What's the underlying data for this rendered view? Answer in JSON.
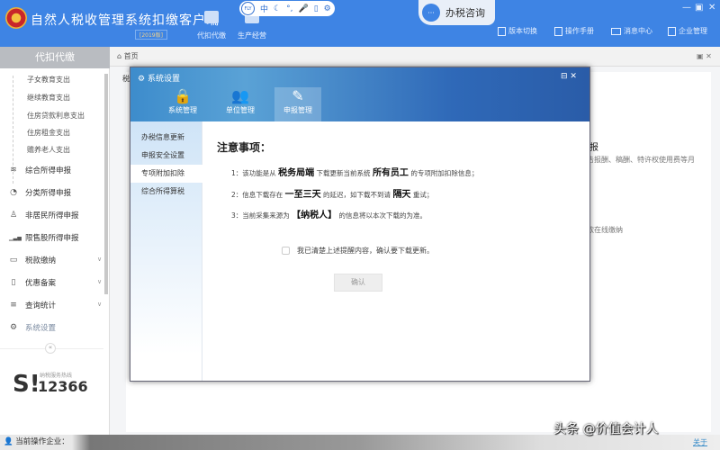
{
  "header": {
    "title": "自然人税收管理系统扣缴客户端",
    "subtitle": "[2019版]",
    "tools": [
      "代扣代缴",
      "生产经营"
    ],
    "flybar": {
      "fly": "FLY",
      "items": [
        "中",
        "☾",
        "°,",
        "🎤",
        "▯",
        "⚙"
      ]
    },
    "consult": "办税咨询",
    "links": [
      "版本切换",
      "操作手册",
      "消息中心",
      "企业管理"
    ],
    "window_controls": [
      "—",
      "▣",
      "✕"
    ]
  },
  "sidebar": {
    "title": "代扣代缴",
    "sub_items": [
      "子女教育支出",
      "继续教育支出",
      "住房贷款利息支出",
      "住房租金支出",
      "赡养老人支出"
    ],
    "items": [
      {
        "label": "综合所得申报",
        "icon": "≋"
      },
      {
        "label": "分类所得申报",
        "icon": "◔"
      },
      {
        "label": "非居民所得申报",
        "icon": "♙"
      },
      {
        "label": "限售股所得申报",
        "icon": "▁▃▅"
      },
      {
        "label": "税款缴纳",
        "icon": "▭"
      },
      {
        "label": "优惠备案",
        "icon": "▯"
      },
      {
        "label": "查询统计",
        "icon": "≡"
      },
      {
        "label": "系统设置",
        "icon": "⚙"
      }
    ],
    "collapse": "«",
    "hotline_label": "纳税服务热线",
    "hotline": "12366"
  },
  "breadcrumb": {
    "home": "首页",
    "bg_ctl": "▣ ✕"
  },
  "background": {
    "t1": "税",
    "t2": "报",
    "t3": "告报酬、稿酬、特许权使用费等月",
    "t4": "款在线缴纳"
  },
  "dialog": {
    "title": "系统设置",
    "controls": "⊟  ✕",
    "tabs": [
      {
        "label": "系统管理",
        "icon": "🔒"
      },
      {
        "label": "单位管理",
        "icon": "👥"
      },
      {
        "label": "申报管理",
        "icon": "✎"
      }
    ],
    "nav": [
      "办税信息更新",
      "申报安全设置",
      "专项附加扣除",
      "综合所得算税"
    ],
    "notice_title": "注意事项：",
    "notes": [
      [
        "1：该功能是从 ",
        "税务局端",
        " 下载更新当前系统 ",
        "所有员工",
        " 的专项附加扣除信息；"
      ],
      [
        "2：信息下载存在 ",
        "一至三天",
        " 的延迟，如下载不到请 ",
        "隔天",
        " 重试；"
      ],
      [
        "3：当前采集来源为 ",
        "【纳税人】",
        " 的信息将以本次下载的为准。",
        "",
        ""
      ]
    ],
    "agree": "我已清楚上述提醒内容，确认要下载更新。",
    "confirm": "确认"
  },
  "status": {
    "company_label": "当前操作企业：",
    "about": "关于"
  },
  "watermark": "头条 @价值会计人"
}
